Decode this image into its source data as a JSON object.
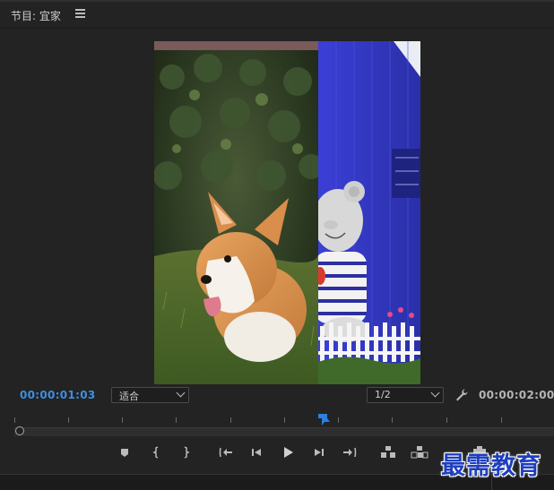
{
  "panel": {
    "title": "节目: 宜家",
    "menu_icon": "hamburger-menu-icon"
  },
  "viewer": {
    "left_clip": "corgi-dog-photo",
    "right_clip": "blue-building-bear-statue-photo"
  },
  "timecode": {
    "current": "00:00:01:03",
    "duration": "00:00:02:00"
  },
  "fit_select": {
    "value": "适合"
  },
  "resolution_select": {
    "value": "1/2"
  },
  "playhead_fraction": 0.57,
  "transport": [
    {
      "name": "add-marker-button",
      "icon": "marker-icon"
    },
    {
      "name": "mark-in-button",
      "icon": "mark-in-icon"
    },
    {
      "name": "mark-out-button",
      "icon": "mark-out-icon"
    },
    {
      "name": "go-to-in-button",
      "icon": "go-to-in-icon"
    },
    {
      "name": "step-back-button",
      "icon": "step-back-icon"
    },
    {
      "name": "play-button",
      "icon": "play-icon"
    },
    {
      "name": "step-forward-button",
      "icon": "step-forward-icon"
    },
    {
      "name": "go-to-out-button",
      "icon": "go-to-out-icon"
    },
    {
      "name": "lift-button",
      "icon": "lift-icon"
    },
    {
      "name": "extract-button",
      "icon": "extract-icon"
    },
    {
      "name": "export-frame-button",
      "icon": "camera-icon"
    }
  ],
  "watermark": "最需教育",
  "colors": {
    "accent": "#3d8fe0",
    "panel_bg": "#232323",
    "watermark": "#1f3fbf"
  }
}
